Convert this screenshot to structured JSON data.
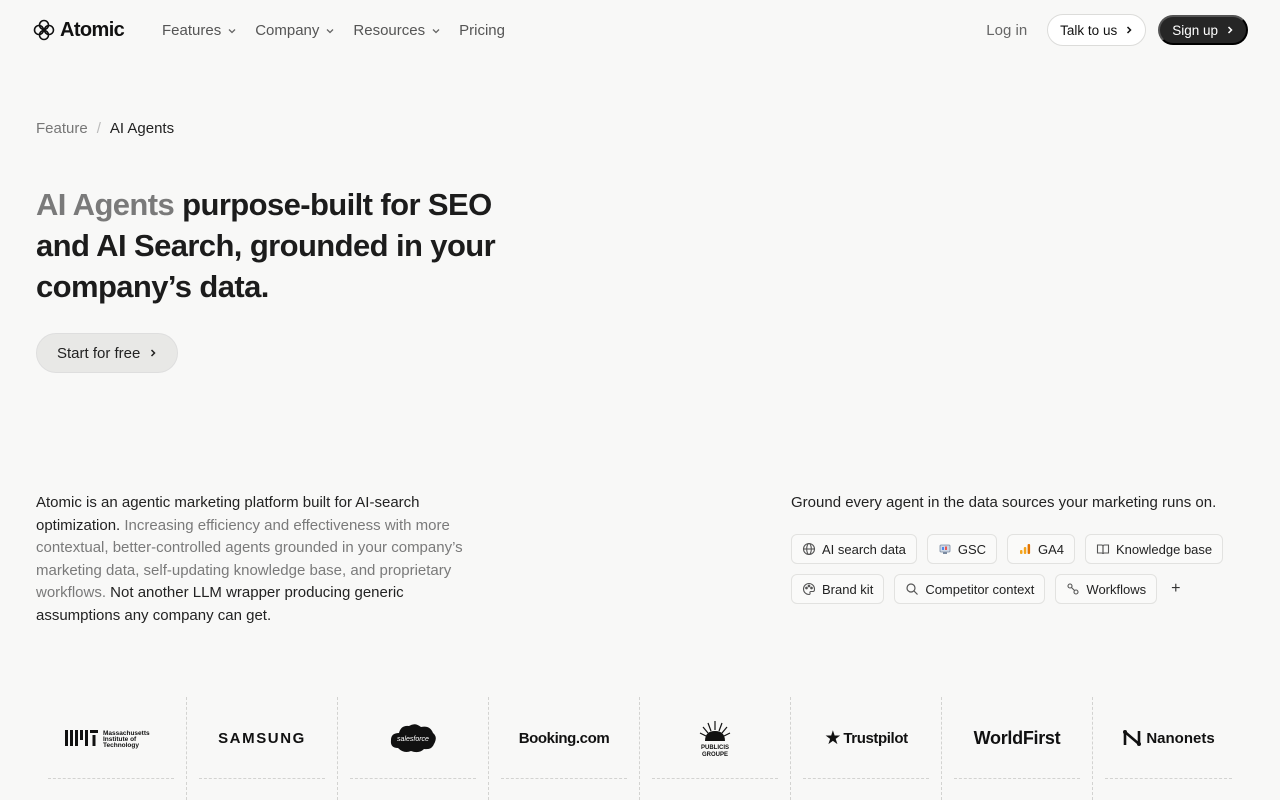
{
  "brand": {
    "name": "Atomic"
  },
  "nav": {
    "links": [
      {
        "label": "Features",
        "dropdown": true
      },
      {
        "label": "Company",
        "dropdown": true
      },
      {
        "label": "Resources",
        "dropdown": true
      },
      {
        "label": "Pricing",
        "dropdown": false
      }
    ],
    "login": "Log in",
    "talk": "Talk to us",
    "signup": "Sign up"
  },
  "breadcrumb": {
    "parent": "Feature",
    "separator": "/",
    "current": "AI Agents"
  },
  "hero": {
    "accent": "AI Agents",
    "title_rest": " purpose-built for SEO and AI Search, grounded in your company’s data.",
    "cta": "Start for free"
  },
  "description": {
    "lead": "Atomic is an agentic marketing platform built for AI-search optimization.",
    "muted": " Increasing efficiency and effectiveness with more contextual, better-controlled agents grounded in your company’s marketing data, self-updating knowledge base, and proprietary workflows.",
    "tail": " Not another LLM wrapper producing generic assumptions any company can get."
  },
  "ground": {
    "text": "Ground every agent in the data sources your marketing runs on.",
    "chips": [
      {
        "label": "AI search data",
        "icon": "globe-icon"
      },
      {
        "label": "GSC",
        "icon": "gsc-icon"
      },
      {
        "label": "GA4",
        "icon": "ga4-icon"
      },
      {
        "label": "Knowledge base",
        "icon": "book-icon"
      },
      {
        "label": "Brand kit",
        "icon": "palette-icon"
      },
      {
        "label": "Competitor context",
        "icon": "search-icon"
      },
      {
        "label": "Workflows",
        "icon": "workflow-icon"
      }
    ],
    "more": "+"
  },
  "logos": {
    "mit": {
      "mark": "MIT",
      "lines": [
        "Massachusetts",
        "Institute of",
        "Technology"
      ]
    },
    "samsung": "SAMSUNG",
    "salesforce": "salesforce",
    "booking": "Booking.com",
    "publicis": [
      "PUBLICIS",
      "GROUPE"
    ],
    "trustpilot": "Trustpilot",
    "worldfirst": "WorldFirst",
    "nanonets": "Nanonets"
  },
  "colors": {
    "dark_button": "#262626",
    "background": "#f8f8f7",
    "ga4": "#f4a41c",
    "trustpilot_star": "#111111"
  }
}
